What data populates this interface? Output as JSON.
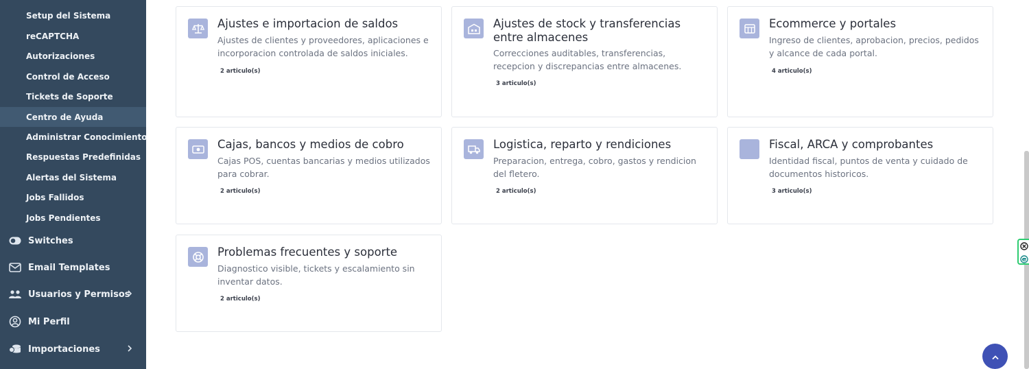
{
  "sidebar": {
    "sub_items": [
      {
        "label": "Setup del Sistema",
        "active": false
      },
      {
        "label": "reCAPTCHA",
        "active": false
      },
      {
        "label": "Autorizaciones",
        "active": false
      },
      {
        "label": "Control de Acceso",
        "active": false
      },
      {
        "label": "Tickets de Soporte",
        "active": false
      },
      {
        "label": "Centro de Ayuda",
        "active": true
      },
      {
        "label": "Administrar Conocimiento",
        "active": false
      },
      {
        "label": "Respuestas Predefinidas",
        "active": false
      },
      {
        "label": "Alertas del Sistema",
        "active": false
      },
      {
        "label": "Jobs Fallidos",
        "active": false
      },
      {
        "label": "Jobs Pendientes",
        "active": false
      }
    ],
    "main_items": [
      {
        "label": "Switches",
        "icon": "toggle-icon",
        "has_children": false
      },
      {
        "label": "Email Templates",
        "icon": "mail-icon",
        "has_children": false
      },
      {
        "label": "Usuarios y Permisos",
        "icon": "users-icon",
        "has_children": true
      },
      {
        "label": "Mi Perfil",
        "icon": "user-circle-icon",
        "has_children": false
      },
      {
        "label": "Importaciones",
        "icon": "database-icon",
        "has_children": true
      }
    ]
  },
  "categories": [
    {
      "title": "Ajustes e importacion de saldos",
      "description": "Ajustes de clientes y proveedores, aplicaciones e incorporacion controlada de saldos iniciales.",
      "count": "2 articulo(s)",
      "icon": "scale-icon"
    },
    {
      "title": "Ajustes de stock y transferencias entre almacenes",
      "description": "Correcciones auditables, transferencias, recepcion y discrepancias entre almacenes.",
      "count": "3 articulo(s)",
      "icon": "warehouse-icon"
    },
    {
      "title": "Ecommerce y portales",
      "description": "Ingreso de clientes, aprobacion, precios, pedidos y alcance de cada portal.",
      "count": "4 articulo(s)",
      "icon": "storefront-icon"
    },
    {
      "title": "Cajas, bancos y medios de cobro",
      "description": "Cajas POS, cuentas bancarias y medios utilizados para cobrar.",
      "count": "2 articulo(s)",
      "icon": "cash-icon"
    },
    {
      "title": "Logistica, reparto y rendiciones",
      "description": "Preparacion, entrega, cobro, gastos y rendicion del fletero.",
      "count": "2 articulo(s)",
      "icon": "truck-icon"
    },
    {
      "title": "Fiscal, ARCA y comprobantes",
      "description": "Identidad fiscal, puntos de venta y cuidado de documentos historicos.",
      "count": "3 articulo(s)",
      "icon": "receipt-icon"
    },
    {
      "title": "Problemas frecuentes y soporte",
      "description": "Diagnostico visible, tickets y escalamiento sin inventar datos.",
      "count": "2 articulo(s)",
      "icon": "lifebuoy-icon"
    }
  ],
  "colors": {
    "sidebar_bg": "#34495e",
    "sidebar_active": "#415a72",
    "icon_tile": "#a9b4dc",
    "scroll_top_button": "#3f51b5",
    "widget_border": "#2ecc71"
  }
}
